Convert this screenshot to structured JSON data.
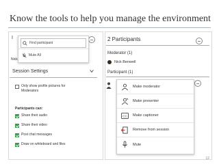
{
  "slide": {
    "title": "Know the tools to help you manage the environment",
    "page_number": "12"
  },
  "left_panel": {
    "partial_header": "I",
    "name_row": "Nick Benwell"
  },
  "popup_menu": {
    "find_label": "Find participant",
    "mute_label": "Mute All"
  },
  "session_settings": {
    "title": "Session Settings",
    "profile_option_line1": "Only show profile pictures for",
    "profile_option_line2": "Moderators",
    "participants_can": "Participants can:",
    "options": [
      {
        "label": "Share their audio",
        "checked": true
      },
      {
        "label": "Share their video",
        "checked": true
      },
      {
        "label": "Post chat messages",
        "checked": true
      },
      {
        "label": "Draw on whiteboard and files",
        "checked": true
      }
    ]
  },
  "participants_panel": {
    "title": "2 Participants",
    "moderator_header": "Moderator (1)",
    "moderator_name": "Nick Benwell",
    "participant_header": "Participant (1)"
  },
  "action_menu": {
    "items": [
      {
        "label": "Make moderator",
        "icon": "moderator-icon"
      },
      {
        "label": "Make presenter",
        "icon": "presenter-icon"
      },
      {
        "label": "Make captioner",
        "icon": "captioner-icon"
      },
      {
        "label": "Remove from session",
        "icon": "remove-icon"
      },
      {
        "label": "Mute",
        "icon": "mute-icon"
      }
    ]
  },
  "colors": {
    "check_green": "#3c9a51",
    "title_rule": "#9fb6c9"
  }
}
